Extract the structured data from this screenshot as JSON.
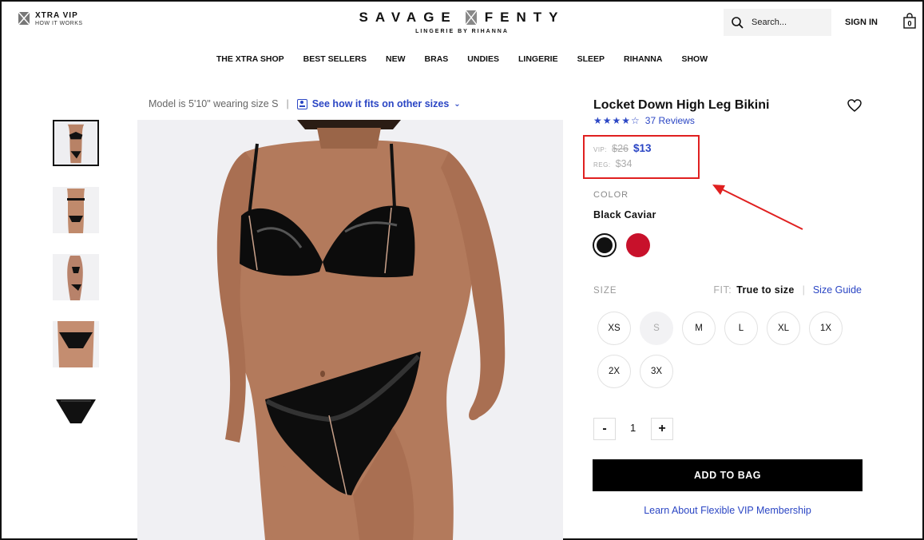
{
  "header": {
    "vip_title": "XTRA VIP",
    "vip_sub": "HOW IT WORKS",
    "brand_left": "SAVAGE",
    "brand_right": "FENTY",
    "brand_sub": "LINGERIE BY RIHANNA",
    "search_placeholder": "Search...",
    "sign_in": "SIGN IN",
    "bag_count": "0"
  },
  "nav": [
    "THE XTRA SHOP",
    "BEST SELLERS",
    "NEW",
    "BRAS",
    "UNDIES",
    "LINGERIE",
    "SLEEP",
    "RIHANNA",
    "SHOW"
  ],
  "fit_line": {
    "model_text": "Model is 5'10\" wearing size S",
    "separator": "|",
    "link_text": "See how it fits on other sizes",
    "chevron": "⌄"
  },
  "product": {
    "title": "Locket Down High Leg Bikini",
    "stars": "★★★★☆",
    "rating": 4,
    "reviews": "37 Reviews",
    "vip_label": "VIP:",
    "vip_old_price": "$26",
    "vip_price": "$13",
    "reg_label": "REG:",
    "reg_price": "$34",
    "color_label": "COLOR",
    "color_value": "Black Caviar",
    "size_label": "SIZE",
    "fit_label": "FIT:",
    "fit_value": "True to size",
    "fit_pipe": "|",
    "size_guide": "Size Guide",
    "sizes": [
      "XS",
      "S",
      "M",
      "L",
      "XL",
      "1X",
      "2X",
      "3X"
    ],
    "qty_minus": "-",
    "qty": "1",
    "qty_plus": "+",
    "add_to_bag": "ADD TO BAG",
    "learn_link": "Learn About Flexible VIP Membership"
  },
  "colors": {
    "accent_blue": "#2b46c4",
    "highlight_red": "#e02020",
    "swatch_black": "#111111",
    "swatch_red": "#c8112b"
  }
}
